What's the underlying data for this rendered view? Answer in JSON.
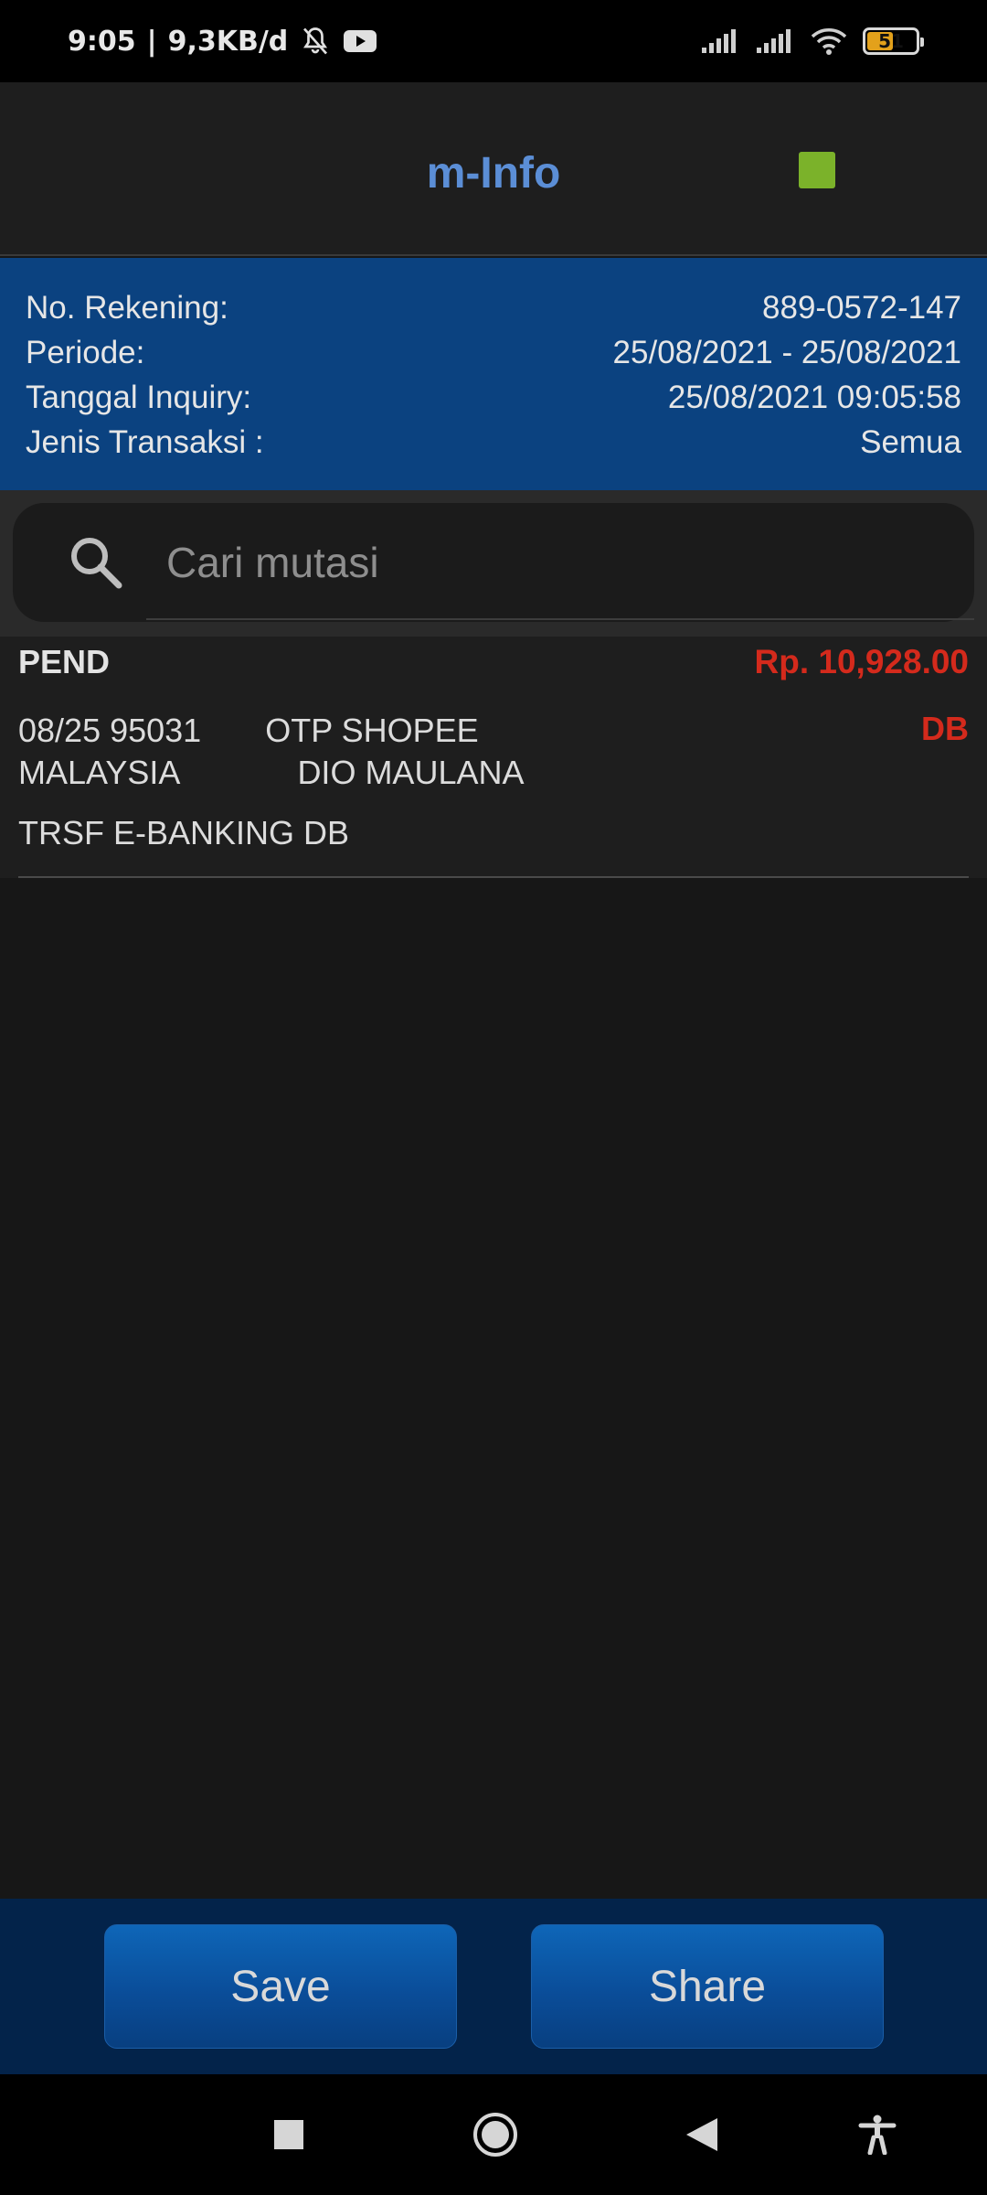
{
  "status_bar": {
    "time": "9:05",
    "separator": "|",
    "speed": "9,3KB/d",
    "battery_level": "51",
    "battery_color": "#e3a11b",
    "icons": [
      "mute-bell-icon",
      "youtube-icon",
      "signal-icon",
      "signal-icon",
      "wifi-icon",
      "battery-icon"
    ]
  },
  "header": {
    "title": "m-Info",
    "title_color": "#5b8ed6",
    "indicator_color": "#7bb22a"
  },
  "info": {
    "rows": [
      {
        "label": "No. Rekening:",
        "value": "889-0572-147"
      },
      {
        "label": "Periode:",
        "value": "25/08/2021 - 25/08/2021"
      },
      {
        "label": "Tanggal Inquiry:",
        "value": "25/08/2021 09:05:58"
      },
      {
        "label": "Jenis Transaksi :",
        "value": "Semua"
      }
    ],
    "background": "#0b4280"
  },
  "search": {
    "placeholder": "Cari mutasi",
    "icon": "search-icon"
  },
  "transactions": [
    {
      "status": "PEND",
      "amount": "Rp. 10,928.00",
      "line1": "08/25 95031       OTP SHOPEE",
      "line2": "MALAYSIA             DIO MAULANA",
      "type": "DB",
      "description": "TRSF E-BANKING DB"
    }
  ],
  "actions": {
    "save_label": "Save",
    "share_label": "Share"
  },
  "nav": {
    "icons": [
      "square-recents-icon",
      "circle-home-icon",
      "triangle-back-icon",
      "accessibility-icon"
    ]
  }
}
